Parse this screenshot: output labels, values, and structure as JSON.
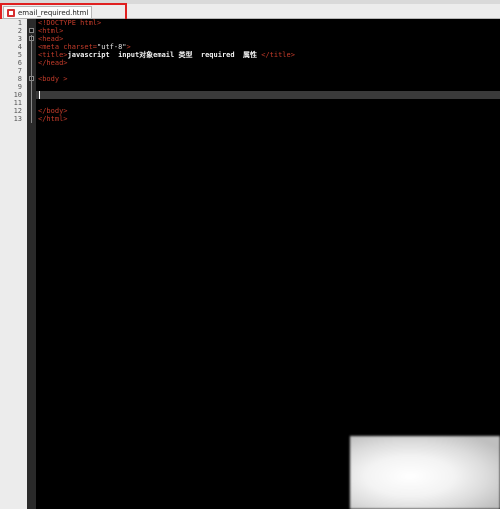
{
  "tab": {
    "filename": "email_required.html"
  },
  "editor": {
    "current_line": 10,
    "lines": [
      {
        "n": "1",
        "fold": "",
        "text": "<!DOCTYPE html>"
      },
      {
        "n": "2",
        "fold": "box",
        "text": "<html>"
      },
      {
        "n": "3",
        "fold": "box",
        "text": "<head>"
      },
      {
        "n": "4",
        "fold": "",
        "text": "<meta charset=\"utf-8\">"
      },
      {
        "n": "5",
        "fold": "",
        "text": "<title>javascript  input对象email 类型  required  属性 </title>"
      },
      {
        "n": "6",
        "fold": "",
        "text": "</head>"
      },
      {
        "n": "7",
        "fold": "",
        "text": ""
      },
      {
        "n": "8",
        "fold": "box",
        "text": "<body >"
      },
      {
        "n": "9",
        "fold": "",
        "text": ""
      },
      {
        "n": "10",
        "fold": "",
        "text": ""
      },
      {
        "n": "11",
        "fold": "",
        "text": ""
      },
      {
        "n": "12",
        "fold": "",
        "text": "</body>"
      },
      {
        "n": "13",
        "fold": "",
        "text": "</html>"
      }
    ]
  }
}
